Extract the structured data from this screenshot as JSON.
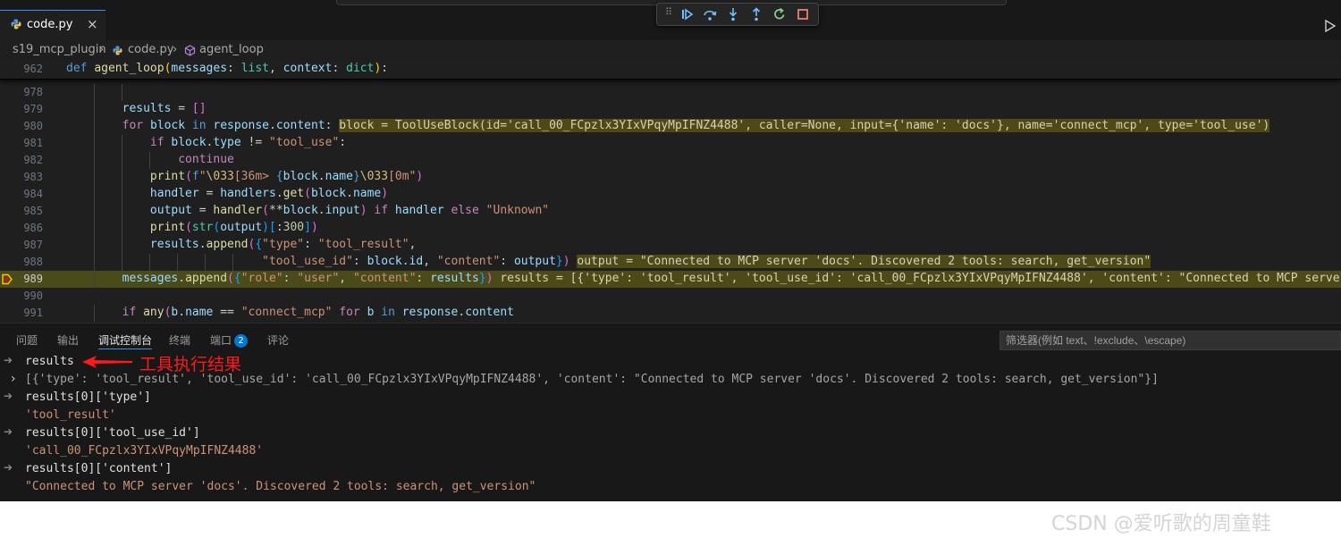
{
  "tab": {
    "filename": "code.py",
    "close": "×"
  },
  "breadcrumb": {
    "folder": "s19_mcp_plugin",
    "file": "code.py",
    "symbol": "agent_loop",
    "sep": "›"
  },
  "sticky": {
    "line_number": "962"
  },
  "editor": {
    "line_numbers": [
      "978",
      "979",
      "980",
      "981",
      "982",
      "983",
      "984",
      "985",
      "986",
      "987",
      "988",
      "989",
      "990",
      "991"
    ],
    "current_line": "989",
    "inline_values": {
      "block": "block = ToolUseBlock(id='call_00_FCpzlx3YIxVPqyMpIFNZ4488', caller=None, input={'name': 'docs'}, name='connect_mcp', type='tool_use')",
      "output": "output = \"Connected to MCP server 'docs'. Discovered 2 tools: search, get_version\"",
      "results": "results = [{'type': 'tool_result', 'tool_use_id': 'call_00_FCpzlx3YIxVPqyMpIFNZ4488', 'content': \"Connected to MCP server '"
    }
  },
  "panel": {
    "tabs": [
      "问题",
      "输出",
      "调试控制台",
      "终端",
      "端口",
      "评论"
    ],
    "active_tab": "调试控制台",
    "ports_badge": "2",
    "filter_placeholder": "筛选器(例如 text、!exclude、\\escape)"
  },
  "console": [
    {
      "kind": "input",
      "text": "results"
    },
    {
      "kind": "output-expandable",
      "text": "[{'type': 'tool_result', 'tool_use_id': 'call_00_FCpzlx3YIxVPqyMpIFNZ4488', 'content': \"Connected to MCP server 'docs'. Discovered 2 tools: search, get_version\"}]"
    },
    {
      "kind": "input",
      "text": "results[0]['type']"
    },
    {
      "kind": "output",
      "text": "'tool_result'"
    },
    {
      "kind": "input",
      "text": "results[0]['tool_use_id']"
    },
    {
      "kind": "output",
      "text": "'call_00_FCpzlx3YIxVPqyMpIFNZ4488'"
    },
    {
      "kind": "input",
      "text": "results[0]['content']"
    },
    {
      "kind": "output",
      "text": "\"Connected to MCP server 'docs'. Discovered 2 tools: search, get_version\""
    }
  ],
  "annotation": {
    "text": "工具执行结果"
  },
  "watermark": {
    "text": "CSDN @爱听歌的周童鞋"
  },
  "icons": {
    "file_icon": "python-file-icon",
    "debug_controls": [
      "continue-icon",
      "step-over-icon",
      "step-into-icon",
      "step-out-icon",
      "restart-icon",
      "stop-icon"
    ],
    "breakpoint": "current-breakpoint-icon"
  },
  "colors": {
    "accent": "#3b8eea",
    "highlight": "#4b4a1a",
    "annotation": "#ff1a1a"
  }
}
